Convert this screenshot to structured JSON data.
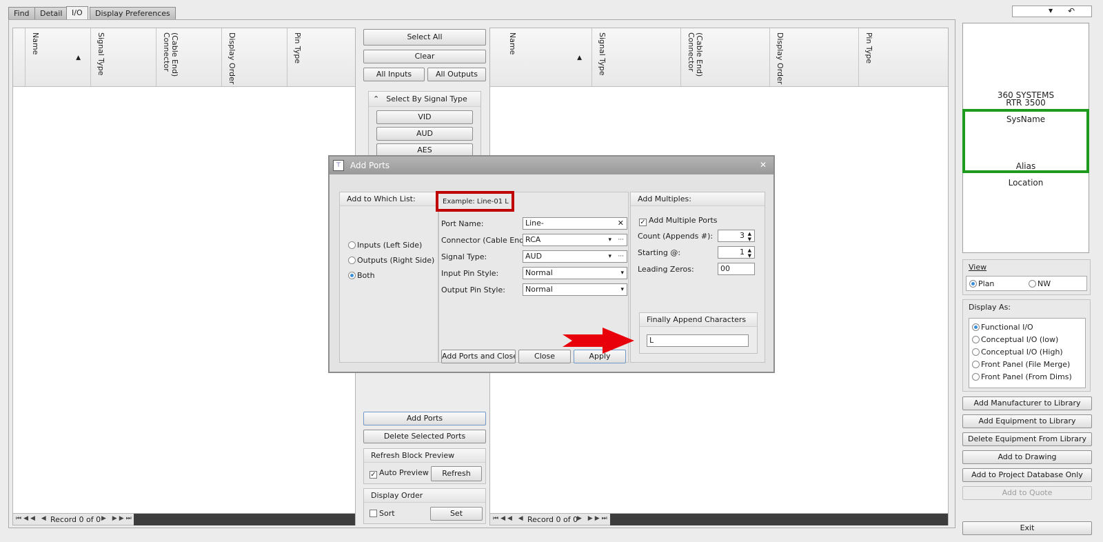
{
  "tabs": [
    {
      "label": "Find"
    },
    {
      "label": "Detail"
    },
    {
      "label": "I/O"
    },
    {
      "label": "Display Preferences"
    }
  ],
  "top_dropdown": {
    "arrow": "▼",
    "undo_icon": "↶"
  },
  "left_grid": {
    "columns": [
      "Name",
      "Signal Type",
      "(Cable End)\nConnector",
      "Display Order",
      "Pin Type"
    ],
    "record_text": "Record 0 of 0"
  },
  "right_grid": {
    "columns": [
      "Name",
      "Signal Type",
      "(Cable End)\nConnector",
      "Display Order",
      "Pin Type"
    ],
    "record_text": "Record 0 of 0"
  },
  "middle": {
    "select_all": "Select All",
    "clear": "Clear",
    "all_inputs": "All Inputs",
    "all_outputs": "All Outputs",
    "select_by_signal_type": "Select By Signal Type",
    "signal_buttons": [
      "VID",
      "AUD",
      "AES"
    ],
    "add_ports": "Add Ports",
    "delete_selected_ports": "Delete Selected Ports",
    "refresh_block_preview": "Refresh Block Preview",
    "auto_preview": "Auto Preview",
    "refresh": "Refresh",
    "display_order": "Display Order",
    "sort": "Sort",
    "set": "Set"
  },
  "preview": {
    "manufacturer": "360 SYSTEMS",
    "model": "RTR 3500",
    "sysname": "SysName",
    "alias": "Alias",
    "location": "Location"
  },
  "view": {
    "title": "View",
    "options": [
      "Plan",
      "NW"
    ],
    "selected": "Plan"
  },
  "display_as": {
    "title": "Display As:",
    "options": [
      "Functional I/O",
      "Conceptual I/O (low)",
      "Conceptual I/O (High)",
      "Front Panel (File Merge)",
      "Front Panel (From Dims)"
    ],
    "selected": "Functional I/O"
  },
  "right_buttons": [
    "Add Manufacturer to Library",
    "Add Equipment to Library",
    "Delete Equipment From Library",
    "Add to Drawing",
    "Add to Project Database Only",
    "Add to Quote"
  ],
  "exit": "Exit",
  "dialog": {
    "title": "Add Ports",
    "close_x": "✕",
    "add_to_list": {
      "title": "Add to Which List:",
      "options": [
        "Inputs (Left Side)",
        "Outputs (Right Side)",
        "Both"
      ],
      "selected": "Both"
    },
    "example": "Example: Line-01 L",
    "fields": {
      "port_name": {
        "label": "Port Name:",
        "value": "Line-"
      },
      "connector": {
        "label": "Connector (Cable End):",
        "value": "RCA"
      },
      "signal_type": {
        "label": "Signal Type:",
        "value": "AUD"
      },
      "input_pin_style": {
        "label": "Input Pin Style:",
        "value": "Normal"
      },
      "output_pin_style": {
        "label": "Output Pin Style:",
        "value": "Normal"
      }
    },
    "multiples": {
      "title": "Add Multiples:",
      "add_multiple_ports": "Add Multiple Ports",
      "count_label": "Count (Appends #):",
      "count": "3",
      "starting_label": "Starting @:",
      "starting": "1",
      "leading_zeros_label": "Leading Zeros:",
      "leading_zeros": "00",
      "finally_append_title": "Finally Append Characters",
      "finally_append_value": "L"
    },
    "buttons": {
      "add_and_close": "Add Ports and Close",
      "close": "Close",
      "apply": "Apply"
    }
  },
  "colors": {
    "highlight_red": "#c00000",
    "preview_green": "#1e9a1e",
    "arrow_red": "#e8000a"
  }
}
